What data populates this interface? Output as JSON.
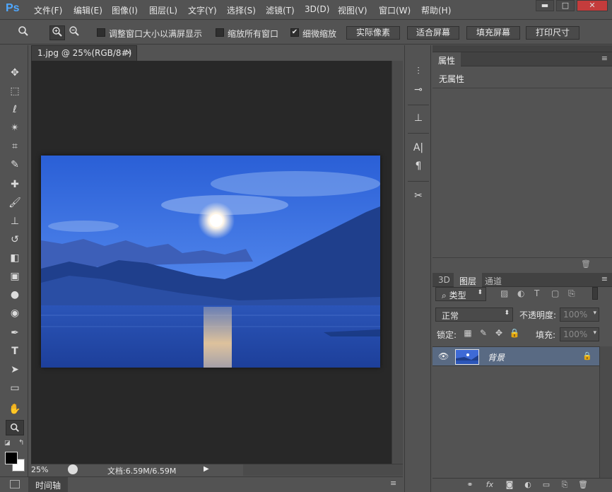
{
  "menubar": {
    "logo": "Ps",
    "items": [
      "文件(F)",
      "编辑(E)",
      "图像(I)",
      "图层(L)",
      "文字(Y)",
      "选择(S)",
      "滤镜(T)",
      "3D(D)",
      "视图(V)",
      "窗口(W)",
      "帮助(H)"
    ],
    "window_buttons": [
      "▬",
      "□",
      "✕"
    ]
  },
  "options": {
    "resize_windows_label": "调整窗口大小以满屏显示",
    "zoom_all_label": "缩放所有窗口",
    "scrubby_zoom_label": "细微缩放",
    "scrubby_zoom_checked": "✔",
    "buttons": [
      "实际像素",
      "适合屏幕",
      "填充屏幕",
      "打印尺寸"
    ]
  },
  "document": {
    "tab_title": "1.jpg @ 25%(RGB/8#)",
    "close": "×",
    "zoom_level": "25%",
    "doc_size": "文档:6.59M/6.59M",
    "timeline_label": "时间轴"
  },
  "properties": {
    "tab": "属性",
    "content": "无属性"
  },
  "layers": {
    "tabs": [
      "3D",
      "图层",
      "通道"
    ],
    "filter_kind": "类型",
    "blend_mode": "正常",
    "opacity_label": "不透明度:",
    "opacity_value": "100%",
    "lock_label": "锁定:",
    "fill_label": "填充:",
    "fill_value": "100%",
    "layer_name": "背景"
  },
  "colors": {
    "accent": "#4fa8ff",
    "selected_layer": "#596a83"
  }
}
